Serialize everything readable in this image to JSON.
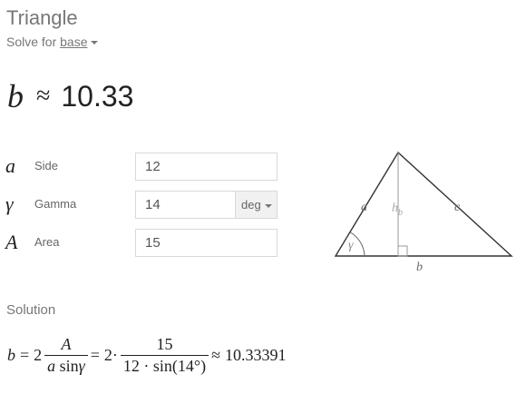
{
  "header": {
    "title": "Triangle",
    "subtitle_prefix": "Solve for",
    "solve_for": "base"
  },
  "result": {
    "symbol": "b",
    "approx": "≈",
    "value": "10.33"
  },
  "inputs": [
    {
      "symbol": "a",
      "label": "Side",
      "value": "12"
    },
    {
      "symbol": "γ",
      "label": "Gamma",
      "value": "14",
      "unit": "deg"
    },
    {
      "symbol": "A",
      "label": "Area",
      "value": "15"
    }
  ],
  "diagram": {
    "label_a": "a",
    "label_c": "c",
    "label_b": "b",
    "label_h": "h",
    "label_h_sub": "b",
    "label_gamma": "γ"
  },
  "solution": {
    "label": "Solution",
    "lhs": "b",
    "eq": "=",
    "two": "2",
    "num1": "A",
    "den1_a": "a",
    "den1_sin": "sin",
    "den1_gamma": "γ",
    "num2": "15",
    "den2": "12 · sin(14°)",
    "cdot": "·",
    "approx": "≈",
    "result": "10.33391"
  }
}
